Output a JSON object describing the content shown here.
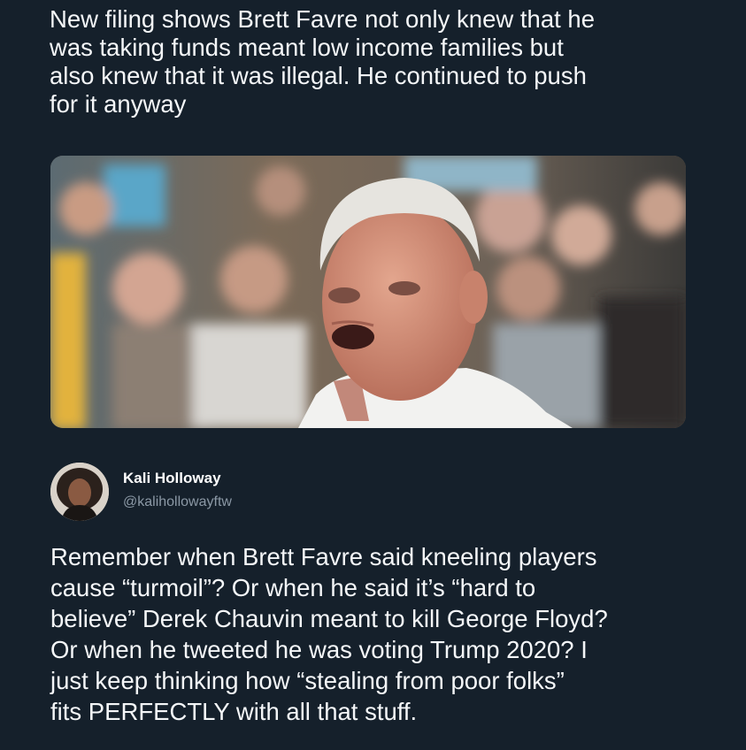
{
  "top_post": {
    "text": "New filing shows Brett Favre not only knew that he\nwas taking funds meant low income families but\nalso knew that it was illegal. He continued to push\nfor it anyway"
  },
  "quoted_tweet": {
    "author_name": "Kali Holloway",
    "author_handle": "@kalihollowayftw",
    "text": "Remember when Brett Favre said kneeling players\ncause “turmoil”? Or when he said it’s “hard to\nbelieve” Derek Chauvin meant to kill George Floyd?\nOr when he tweeted he was voting Trump 2020? I\njust keep thinking how “stealing from poor folks”\nfits PERFECTLY with all that stuff."
  },
  "colors": {
    "background": "#15202b",
    "text": "#f4f6f8",
    "secondary_text": "#8b98a5"
  }
}
